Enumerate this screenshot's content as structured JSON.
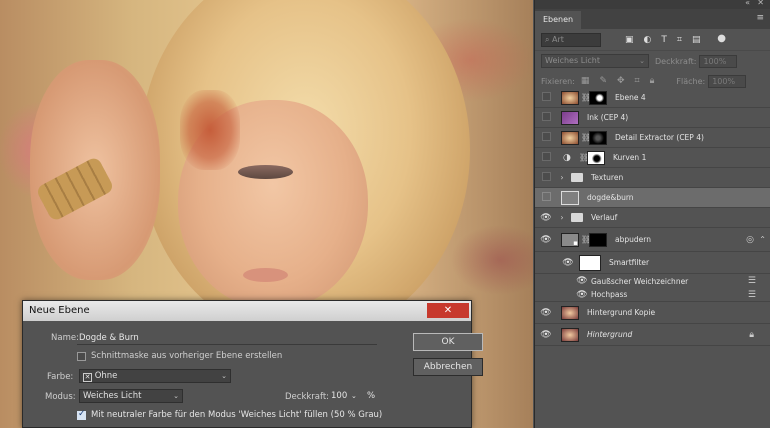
{
  "panel": {
    "tab_label": "Ebenen",
    "filter_placeholder": "Art",
    "blend_mode": "Weiches Licht",
    "opacity_label": "Deckkraft:",
    "opacity_value": "100%",
    "lock_label": "Fixieren:",
    "fill_label": "Fläche:",
    "fill_value": "100%"
  },
  "layers": [
    {
      "name": "Ebene 4",
      "visible": false,
      "thumb": "photo",
      "mask": true
    },
    {
      "name": "Ink (CEP 4)",
      "visible": false,
      "thumb": "purple",
      "mask": false
    },
    {
      "name": "Detail Extractor (CEP 4)",
      "visible": false,
      "thumb": "photo",
      "mask": true
    },
    {
      "name": "Kurven 1",
      "visible": false,
      "thumb": "adjust",
      "mask": true
    },
    {
      "name": "Texturen",
      "visible": false,
      "thumb": "folder",
      "mask": false
    },
    {
      "name": "dogde&burn",
      "visible": false,
      "thumb": "gray",
      "mask": false,
      "selected": true
    },
    {
      "name": "Verlauf",
      "visible": true,
      "thumb": "folder",
      "mask": false
    },
    {
      "name": "abpudern",
      "visible": true,
      "thumb": "smart",
      "mask": true
    },
    {
      "name": "Smartfilter",
      "visible": true,
      "thumb": "white",
      "mask": false
    },
    {
      "name": "Gaußscher Weichzeichner",
      "visible": true,
      "thumb": "none",
      "mask": false
    },
    {
      "name": "Hochpass",
      "visible": true,
      "thumb": "none",
      "mask": false
    },
    {
      "name": "Hintergrund Kopie",
      "visible": true,
      "thumb": "photo",
      "mask": false
    },
    {
      "name": "Hintergrund",
      "visible": true,
      "thumb": "photo",
      "mask": false
    }
  ],
  "dialog": {
    "title": "Neue Ebene",
    "close_symbol": "✕",
    "name_label": "Name:",
    "name_value": "Dogde & Burn",
    "clip_mask_label": "Schnittmaske aus vorheriger Ebene erstellen",
    "color_label": "Farbe:",
    "color_value": "Ohne",
    "mode_label": "Modus:",
    "mode_value": "Weiches Licht",
    "opacity_label": "Deckkraft:",
    "opacity_value": "100",
    "opacity_unit": "%",
    "neutral_fill_label": "Mit neutraler Farbe für den Modus 'Weiches Licht' füllen (50 % Grau)",
    "ok_label": "OK",
    "cancel_label": "Abbrechen"
  }
}
